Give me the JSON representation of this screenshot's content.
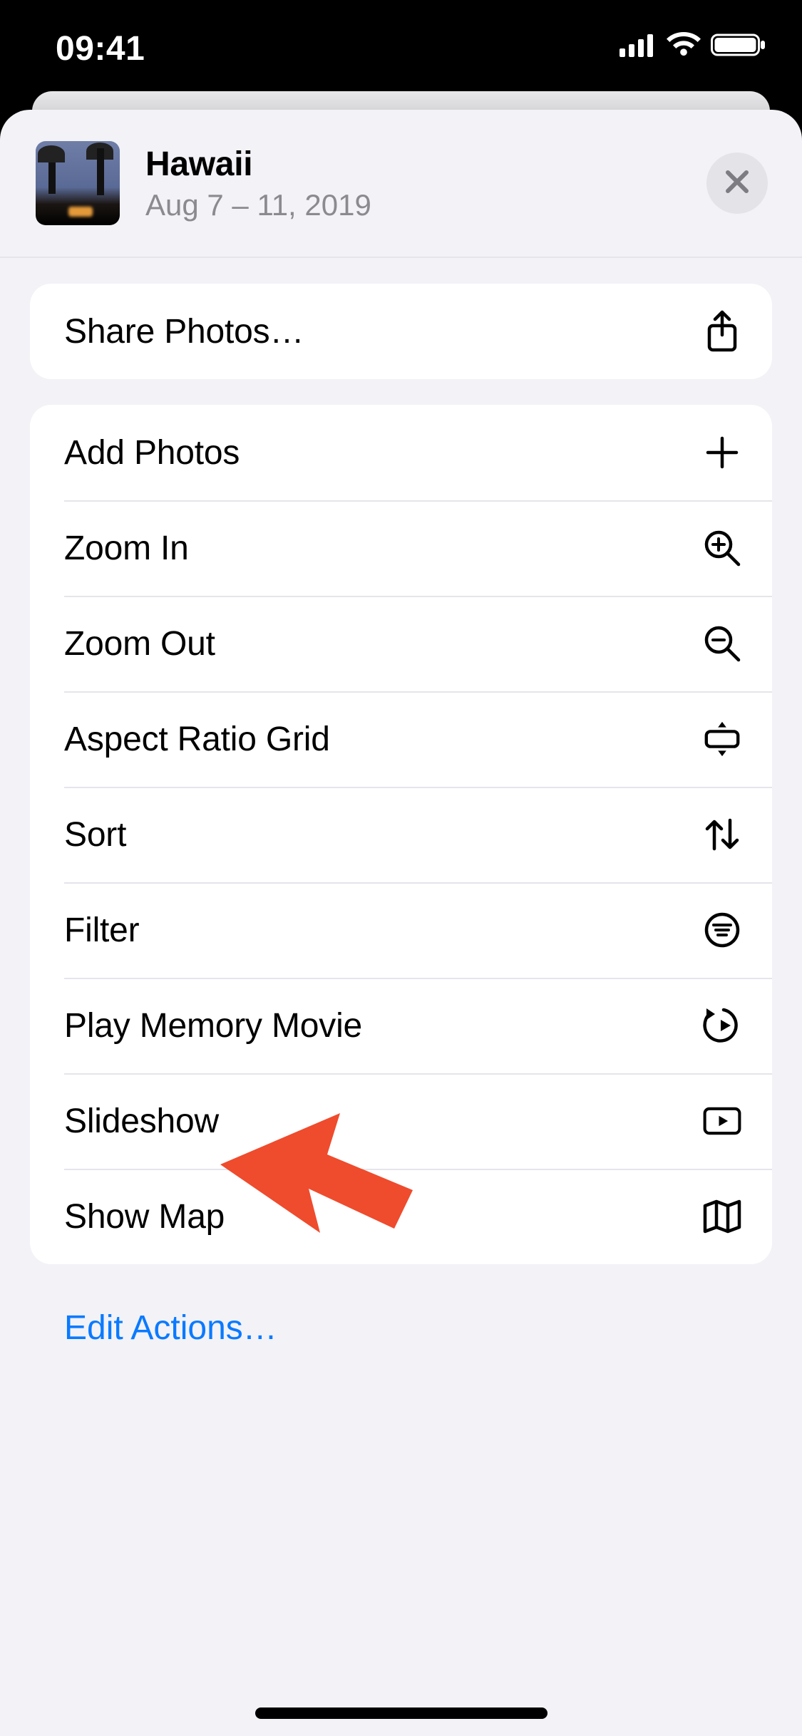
{
  "status": {
    "time": "09:41"
  },
  "header": {
    "title": "Hawaii",
    "subtitle": "Aug 7 – 11, 2019"
  },
  "groups": [
    {
      "rows": [
        {
          "label": "Share Photos…",
          "icon": "share-icon",
          "name": "share-photos-row"
        }
      ]
    },
    {
      "rows": [
        {
          "label": "Add Photos",
          "icon": "plus-icon",
          "name": "add-photos-row"
        },
        {
          "label": "Zoom In",
          "icon": "zoom-in-icon",
          "name": "zoom-in-row"
        },
        {
          "label": "Zoom Out",
          "icon": "zoom-out-icon",
          "name": "zoom-out-row"
        },
        {
          "label": "Aspect Ratio Grid",
          "icon": "aspect-ratio-icon",
          "name": "aspect-ratio-grid-row"
        },
        {
          "label": "Sort",
          "icon": "sort-icon",
          "name": "sort-row"
        },
        {
          "label": "Filter",
          "icon": "filter-icon",
          "name": "filter-row"
        },
        {
          "label": "Play Memory Movie",
          "icon": "memory-movie-icon",
          "name": "play-memory-movie-row"
        },
        {
          "label": "Slideshow",
          "icon": "slideshow-icon",
          "name": "slideshow-row"
        },
        {
          "label": "Show Map",
          "icon": "map-icon",
          "name": "show-map-row"
        }
      ]
    }
  ],
  "footer": {
    "edit_actions": "Edit Actions…"
  },
  "annotation": {
    "target": "slideshow-row"
  },
  "colors": {
    "accent": "#0a7aff",
    "arrow": "#ef4b2d"
  }
}
